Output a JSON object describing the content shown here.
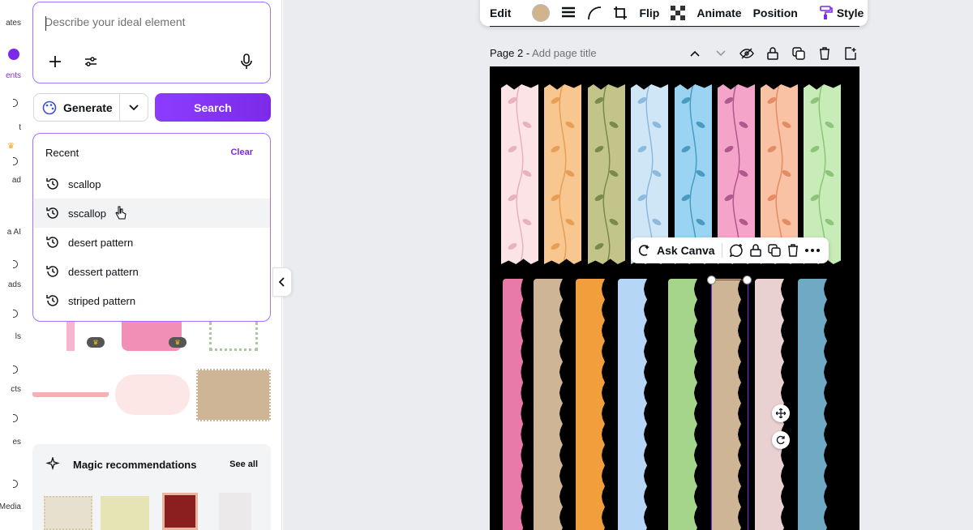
{
  "rail": {
    "items": [
      "ates",
      "ents",
      "t",
      "ad",
      "a AI",
      "ads",
      "ls",
      "cts",
      "es",
      "Media"
    ]
  },
  "search": {
    "placeholder": "Describe your ideal element"
  },
  "actions": {
    "generate_label": "Generate",
    "search_label": "Search"
  },
  "recent": {
    "title": "Recent",
    "clear_label": "Clear",
    "items": [
      "scallop",
      "sscallop",
      "desert pattern",
      "dessert pattern",
      "striped pattern"
    ]
  },
  "magic": {
    "title": "Magic recommendations",
    "see_all": "See all"
  },
  "toolbar": {
    "edit": "Edit",
    "flip": "Flip",
    "animate": "Animate",
    "position": "Position",
    "style": "Style",
    "color_swatch": "#d1b48e"
  },
  "page": {
    "label": "Page 2 -",
    "title_placeholder": "Add page title"
  },
  "context_menu": {
    "ask_canva": "Ask Canva"
  },
  "colors": {
    "accent": "#7d2ae8",
    "washi": [
      "#fbe3e6",
      "#f8c68f",
      "#c2c48a",
      "#cfe6f7",
      "#9bd4f2",
      "#f4a4c8",
      "#f9c2a5",
      "#c8ecb8"
    ],
    "washi_leaf": [
      "#e7b2bd",
      "#e79f55",
      "#7a8a4a",
      "#8db9dc",
      "#4a9bc1",
      "#b1588c",
      "#e48c63",
      "#8cc57a"
    ],
    "strips": [
      "#e77aa6",
      "#cdb596",
      "#f19e3d",
      "#b6d6f8",
      "#a4d58b",
      "#cdb596",
      "#e9d1d1",
      "#6fa9c3"
    ]
  }
}
